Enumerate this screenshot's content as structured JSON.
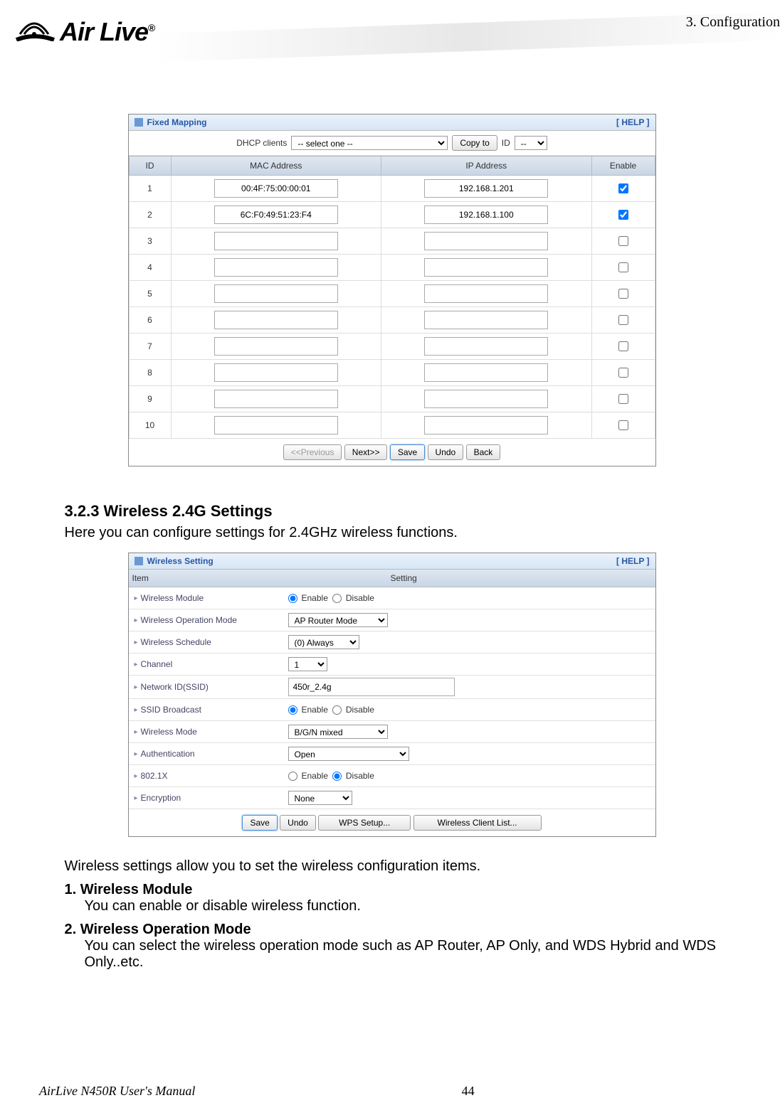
{
  "chapter": "3.  Configuration",
  "logo_text": "Air Live",
  "logo_reg": "®",
  "fixed_mapping": {
    "title": "Fixed Mapping",
    "help": "[ HELP ]",
    "dhcp_label": "DHCP clients",
    "dhcp_select": "-- select one --",
    "copy_btn": "Copy to",
    "id_label": "ID",
    "id_select": "--",
    "columns": {
      "id": "ID",
      "mac": "MAC Address",
      "ip": "IP Address",
      "enable": "Enable"
    },
    "rows": [
      {
        "id": "1",
        "mac": "00:4F:75:00:00:01",
        "ip": "192.168.1.201",
        "checked": true
      },
      {
        "id": "2",
        "mac": "6C:F0:49:51:23:F4",
        "ip": "192.168.1.100",
        "checked": true
      },
      {
        "id": "3",
        "mac": "",
        "ip": "",
        "checked": false
      },
      {
        "id": "4",
        "mac": "",
        "ip": "",
        "checked": false
      },
      {
        "id": "5",
        "mac": "",
        "ip": "",
        "checked": false
      },
      {
        "id": "6",
        "mac": "",
        "ip": "",
        "checked": false
      },
      {
        "id": "7",
        "mac": "",
        "ip": "",
        "checked": false
      },
      {
        "id": "8",
        "mac": "",
        "ip": "",
        "checked": false
      },
      {
        "id": "9",
        "mac": "",
        "ip": "",
        "checked": false
      },
      {
        "id": "10",
        "mac": "",
        "ip": "",
        "checked": false
      }
    ],
    "prev": "<<Previous",
    "next": "Next>>",
    "save": "Save",
    "undo": "Undo",
    "back": "Back"
  },
  "section": {
    "heading": "3.2.3 Wireless 2.4G Settings",
    "intro": "Here you can configure settings for 2.4GHz wireless functions."
  },
  "wireless": {
    "title": "Wireless Setting",
    "help": "[ HELP ]",
    "col_item": "Item",
    "col_setting": "Setting",
    "items": [
      {
        "label": "Wireless Module",
        "type": "radio",
        "opt1": "Enable",
        "opt2": "Disable",
        "sel": 0
      },
      {
        "label": "Wireless Operation Mode",
        "type": "select",
        "value": "AP Router Mode"
      },
      {
        "label": "Wireless Schedule",
        "type": "select",
        "value": "(0) Always"
      },
      {
        "label": "Channel",
        "type": "select",
        "value": "1"
      },
      {
        "label": "Network ID(SSID)",
        "type": "text",
        "value": "450r_2.4g"
      },
      {
        "label": "SSID Broadcast",
        "type": "radio",
        "opt1": "Enable",
        "opt2": "Disable",
        "sel": 0
      },
      {
        "label": "Wireless Mode",
        "type": "select",
        "value": "B/G/N mixed"
      },
      {
        "label": "Authentication",
        "type": "select",
        "value": "Open"
      },
      {
        "label": "802.1X",
        "type": "radio",
        "opt1": "Enable",
        "opt2": "Disable",
        "sel": 1
      },
      {
        "label": "Encryption",
        "type": "select",
        "value": "None"
      }
    ],
    "save": "Save",
    "undo": "Undo",
    "wps": "WPS Setup...",
    "clients": "Wireless Client List..."
  },
  "aftertext": {
    "lead": "Wireless settings allow you to set the wireless configuration items.",
    "item1_t": "1.  Wireless Module",
    "item1_b": "You can enable or disable wireless function.",
    "item2_t": "2.  Wireless Operation Mode",
    "item2_b": "You can select the wireless operation mode such as AP Router, AP Only, and WDS Hybrid and WDS Only..etc."
  },
  "footer": {
    "manual": "AirLive N450R User's Manual",
    "page": "44"
  }
}
